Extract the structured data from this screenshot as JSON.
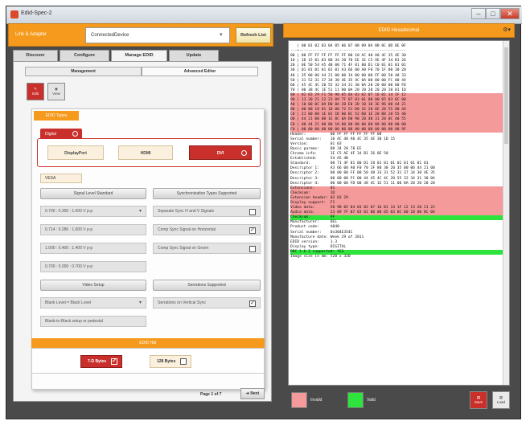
{
  "window": {
    "title": "Edid-Spec-2"
  },
  "device": {
    "label": "Link & Adapter",
    "selected": "ConnectedDevice",
    "refresh_label": "Refresh List"
  },
  "tabs": [
    {
      "label": "Discover"
    },
    {
      "label": "Configure"
    },
    {
      "label": "Manage EDID"
    },
    {
      "label": "Update"
    }
  ],
  "subtabs": [
    {
      "label": "Management"
    },
    {
      "label": "Advanced Editor"
    }
  ],
  "modes": {
    "edit": "Edit",
    "view": "View"
  },
  "edid": {
    "header": "EDID Types",
    "digital_label": "Digital",
    "interfaces": [
      {
        "label": "DisplayPort",
        "active": false
      },
      {
        "label": "HDMI",
        "active": false
      },
      {
        "label": "DVI",
        "active": true
      }
    ],
    "vesa_label": "VESA",
    "left_header": "Signal Level Standard",
    "right_header": "Synchronization Types Supported",
    "levels": [
      "0.700 : 0.300 : 1.000 V p-p",
      "0.714 : 0.286 : 1.000 V p-p",
      "1.000 : 0.400 : 1.400 V p-p",
      "0.700 : 0.000 : 0.700 V p-p"
    ],
    "syncs": [
      {
        "label": "Separate Sync H and V Signals",
        "checked": false
      },
      {
        "label": "Comp Sync Signal on Horizontal",
        "checked": true
      },
      {
        "label": "Comp Sync Signal on Green",
        "checked": false
      }
    ],
    "video_setup_header": "Video Setup",
    "video_setup_value": "Blank Level = Black Level",
    "video_setup_note": "Blank-to-Black setup or pedestal",
    "serrations_header": "Serrations Supported",
    "serrations_label": "Serrations on Vertical Sync",
    "serrations_checked": true
  },
  "edid_hdr": {
    "title": "EDID Hdr",
    "options": [
      {
        "label": "7-D Bytes",
        "active": true
      },
      {
        "label": "128 Bytes",
        "active": false
      }
    ]
  },
  "pager": {
    "info": "Page 1 of 7",
    "next": "Next"
  },
  "hex": {
    "title": "EDID Hexadecimal",
    "lines": [
      {
        "t": "   | 00 01 02 03 04 05 06 07 08 09 0A 0B 0C 0D 0E 0F",
        "hl": ""
      },
      {
        "t": "---+------------------------------------------------",
        "hl": ""
      },
      {
        "t": "00 | 00 FF FF FF FF FF FF 00 10 AC 40 A0 4C 35 4E 30",
        "hl": ""
      },
      {
        "t": "10 | 1D 15 01 03 80 34 20 78 EE 1E C5 AE 4F 34 B1 26",
        "hl": ""
      },
      {
        "t": "20 | 0E 50 54 A5 4B 00 71 4F 81 80 D1 C0 01 01 01 01",
        "hl": ""
      },
      {
        "t": "30 | 01 01 01 01 01 01 A3 66 00 A0 F0 70 1F 80 30 20",
        "hl": ""
      },
      {
        "t": "40 | 35 00 06 44 21 00 00 1A 00 00 00 FF 00 50 48 33",
        "hl": ""
      },
      {
        "t": "50 | 31 52 31 37 34 30 4E 35 4C 0A 00 00 00 FC 00 44",
        "hl": ""
      },
      {
        "t": "60 | 45 4C 4C 20 55 32 34 31 30 0A 20 20 00 00 00 FD",
        "hl": ""
      },
      {
        "t": "70 | 00 38 4C 1E 51 11 00 0A 20 20 20 20 20 20 01 1D",
        "hl": ""
      },
      {
        "t": "80 | 02 03 29 F1 50 90 05 04 03 02 07 16 01 14 1F 12",
        "hl": "red"
      },
      {
        "t": "90 | 13 20 21 22 23 09 7F 07 83 01 00 00 65 03 0C 00",
        "hl": "red"
      },
      {
        "t": "A0 | 10 00 8C 0A D0 8A 20 E0 2D 10 10 3E 96 00 44 21",
        "hl": "red"
      },
      {
        "t": "B0 | 00 00 18 01 1D 00 72 51 D0 1E 20 6E 28 55 00 44",
        "hl": "red"
      },
      {
        "t": "C0 | 21 00 00 1E 01 1D 00 BC 52 D0 1E 20 B8 28 55 40",
        "hl": "red"
      },
      {
        "t": "D0 | 44 21 00 00 1E 8C 0A D0 90 20 40 31 20 0C 40 55",
        "hl": "red"
      },
      {
        "t": "E0 | 00 44 21 00 00 18 00 00 00 00 00 00 00 00 00 00",
        "hl": "red"
      },
      {
        "t": "F0 | 00 00 00 00 00 00 00 00 00 00 00 00 00 00 00 9F",
        "hl": "red"
      },
      {
        "t": "",
        "hl": ""
      },
      {
        "t": "Header:           00 FF FF FF FF FF FF 00",
        "hl": ""
      },
      {
        "t": "Serial number:    10 AC 40 A0 4C 35 4E 30 1D 15",
        "hl": ""
      },
      {
        "t": "Version:          01 03",
        "hl": ""
      },
      {
        "t": "Basic params:     80 34 20 78 EE",
        "hl": ""
      },
      {
        "t": "Chroma info:      1E C5 AE 4F 34 B1 26 0E 50",
        "hl": ""
      },
      {
        "t": "Established:      54 A5 4B",
        "hl": ""
      },
      {
        "t": "Standard:         00 71 4F 81 80 D1 C0 01 01 01 01 01 01 01 01",
        "hl": ""
      },
      {
        "t": "Descriptor 1:     A3 66 00 A0 F0 70 1F 80 30 20 35 00 06 44 21 00",
        "hl": ""
      },
      {
        "t": "Descriptor 2:     00 00 00 FF 00 50 48 33 31 52 31 37 34 30 4E 35",
        "hl": ""
      },
      {
        "t": "Descriptor 3:     00 00 00 FC 00 44 45 4C 4C 20 55 32 34 31 30 0A",
        "hl": ""
      },
      {
        "t": "Descriptor 4:     00 00 00 FD 00 38 4C 1E 51 11 00 0A 20 20 20 20",
        "hl": ""
      },
      {
        "t": "Extensions:       01",
        "hl": "red"
      },
      {
        "t": "Checksum:         1D",
        "hl": "red"
      },
      {
        "t": "",
        "hl": ""
      },
      {
        "t": "Extension header: 02 03 29",
        "hl": "red"
      },
      {
        "t": "Display support:  F1",
        "hl": "red"
      },
      {
        "t": "Video data:       50 90 05 04 03 02 07 16 01 14 1F 12 13 20 21 22",
        "hl": "red"
      },
      {
        "t": "Audio data:       23 09 7F 07 83 01 00 00 65 03 0C 00 10 00 8C 0A",
        "hl": "red"
      },
      {
        "t": "Checksum:         9F",
        "hl": "grn"
      },
      {
        "t": "",
        "hl": ""
      },
      {
        "t": "Manufacturer:     DEL",
        "hl": ""
      },
      {
        "t": "Product code:     A040",
        "hl": ""
      },
      {
        "t": "Serial number:    0x304E354C",
        "hl": ""
      },
      {
        "t": "Manufacture date: Week 29 of 2011",
        "hl": ""
      },
      {
        "t": "EDID version:     1.3",
        "hl": ""
      },
      {
        "t": "Display type:     DIGITAL",
        "hl": ""
      },
      {
        "t": "DDC 1 & 2 supported: YES",
        "hl": "grn"
      },
      {
        "t": "Image size in mm: 520 x 320",
        "hl": ""
      }
    ]
  },
  "legend": {
    "invalid": "Invalid",
    "valid": "Valid"
  },
  "actions": {
    "save": "Save",
    "load": "Load"
  },
  "colors": {
    "accent": "#f59a1c",
    "active": "#c9302c",
    "invalid": "#f59a9a",
    "valid": "#2ee33c"
  }
}
